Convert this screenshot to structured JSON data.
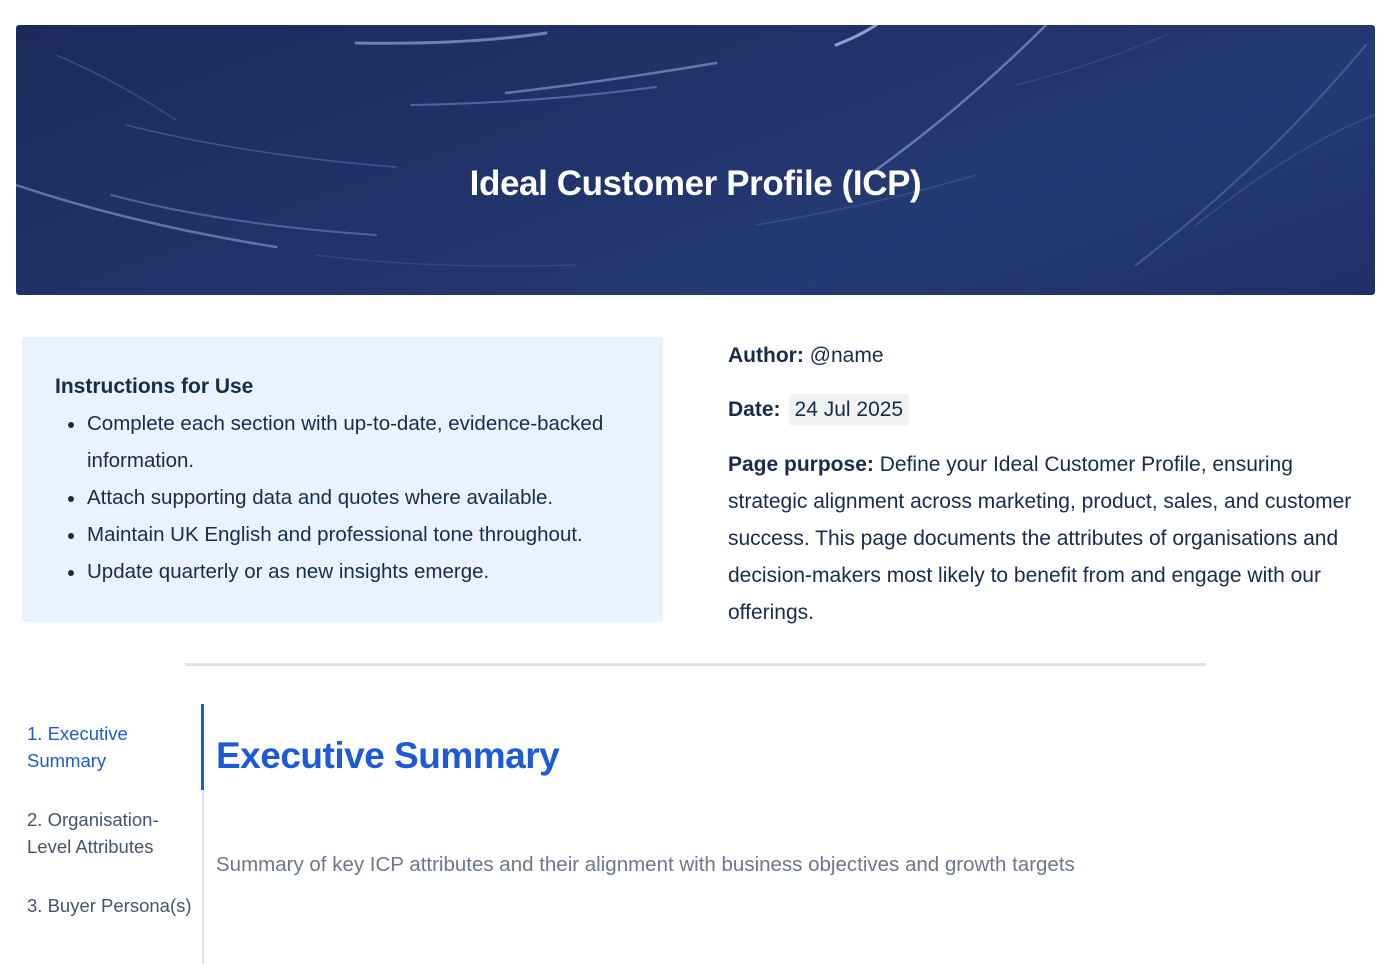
{
  "banner": {
    "title": "Ideal Customer Profile (ICP)"
  },
  "instructions": {
    "heading": "Instructions for Use",
    "items": [
      "Complete each section with up-to-date, evidence-backed information.",
      "Attach supporting data and quotes where available.",
      "Maintain UK English and professional tone throughout.",
      "Update quarterly or as new insights emerge."
    ]
  },
  "meta": {
    "author_label": "Author:",
    "author_value": "@name",
    "date_label": "Date:",
    "date_value": "24 Jul 2025",
    "purpose_label": "Page purpose:",
    "purpose_text": "Define your Ideal Customer Profile, ensuring strategic alignment across marketing, product, sales, and customer success. This page documents the attributes of organisations and decision-makers most likely to benefit from and engage with our offerings."
  },
  "toc": {
    "items": [
      {
        "label": "1. Executive Summary",
        "active": true
      },
      {
        "label": "2. Organisation-Level Attributes",
        "active": false
      },
      {
        "label": "3. Buyer Persona(s)",
        "active": false
      }
    ]
  },
  "section": {
    "title": "Executive Summary",
    "summary": "Summary of key ICP attributes and their alignment with business objectives and growth targets"
  },
  "colors": {
    "banner_bg": "#22336b",
    "accent": "#1d5bd6",
    "panel_bg": "#e9f2fe",
    "muted_text": "#6b778c"
  }
}
